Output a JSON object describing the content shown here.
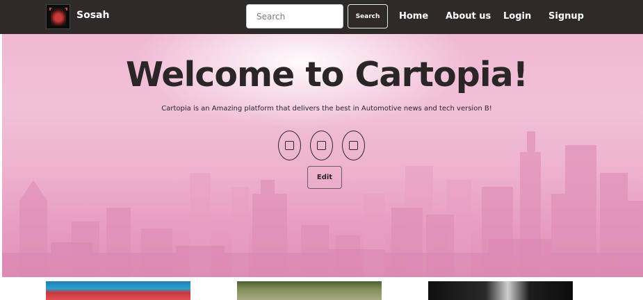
{
  "navbar": {
    "brand": "Sosah",
    "search": {
      "placeholder": "Search",
      "button_label": "Search"
    },
    "links": [
      "Home",
      "About us",
      "Login",
      "Signup"
    ],
    "background": "#2f2a2a"
  },
  "hero": {
    "title": "Welcome to Cartopia!",
    "subtitle": "Cartopia is an Amazing platform that delivers the best in Automotive news and tech version B!",
    "icon_buttons": [
      "square-icon",
      "square-icon",
      "square-icon"
    ],
    "edit_label": "Edit",
    "colors": {
      "pink_top": "#f1c0d8",
      "pink_bottom": "#e290ba",
      "text": "#2a2626"
    }
  },
  "thumbnails": [
    "car-photo",
    "forest-road-photo",
    "black-white-photo"
  ]
}
